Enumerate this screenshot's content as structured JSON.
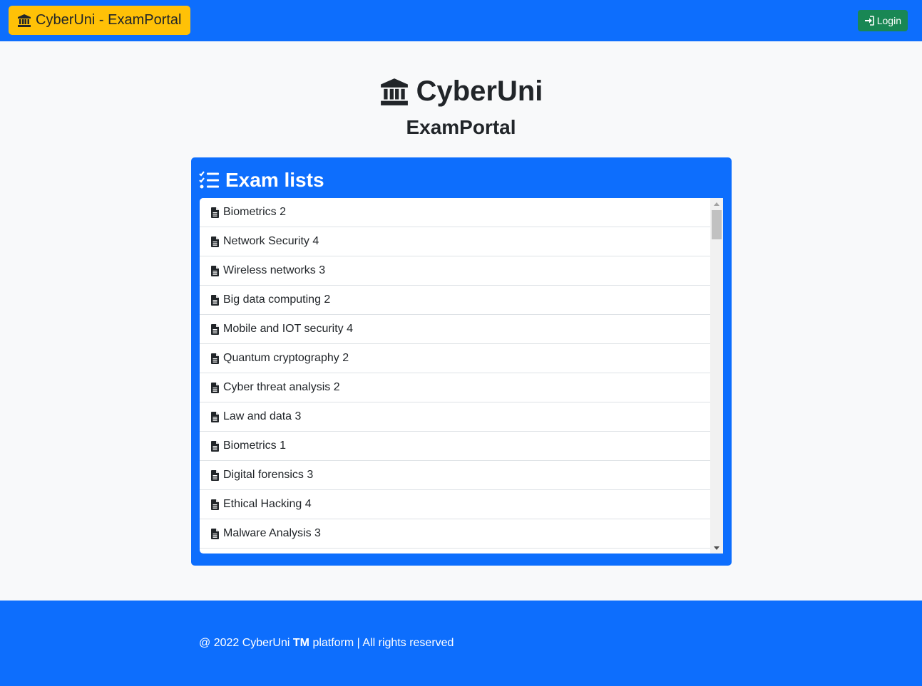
{
  "navbar": {
    "brand_label": "CyberUni - ExamPortal",
    "brand_icon": "university-icon",
    "login_label": "Login",
    "login_icon": "sign-in-icon"
  },
  "hero": {
    "title": "CyberUni",
    "subtitle": "ExamPortal",
    "icon": "university-icon"
  },
  "exam_card": {
    "title": "Exam lists",
    "title_icon": "tasks-icon",
    "item_icon": "file-text-icon",
    "items": [
      "Biometrics 2",
      "Network Security 4",
      "Wireless networks 3",
      "Big data computing 2",
      "Mobile and IOT security 4",
      "Quantum cryptography 2",
      "Cyber threat analysis 2",
      "Law and data 3",
      "Biometrics 1",
      "Digital forensics 3",
      "Ethical Hacking 4",
      "Malware Analysis 3"
    ]
  },
  "footer": {
    "prefix": "@ 2022 CyberUni",
    "tm": "TM",
    "suffix": "platform | All rights reserved"
  },
  "colors": {
    "primary": "#0d6efd",
    "warning": "#ffc107",
    "success": "#198754",
    "background": "#f8f9fa"
  }
}
